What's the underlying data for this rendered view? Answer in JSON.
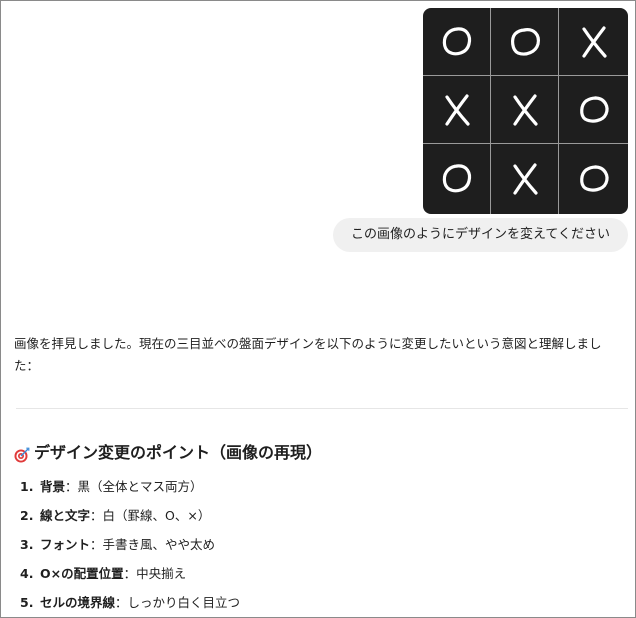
{
  "board": {
    "cells": [
      [
        "O",
        "O",
        "X"
      ],
      [
        "X",
        "X",
        "O"
      ],
      [
        "O",
        "X",
        "O"
      ]
    ],
    "colors": {
      "background": "#1e1e1e",
      "lines": "#9a9a9a",
      "marks": "#ffffff"
    }
  },
  "user_message": "この画像のようにデザインを変えてください",
  "assistant": {
    "intro": "画像を拝見しました。現在の三目並べの盤面デザインを以下のように変更したいという意図と理解しました：",
    "heading_icon": "target-icon",
    "heading": "デザイン変更のポイント（画像の再現）",
    "points": [
      {
        "num": "1.",
        "term": "背景",
        "desc": "：黒（全体とマス両方）"
      },
      {
        "num": "2.",
        "term": "線と文字",
        "desc": "：白（罫線、O、×）"
      },
      {
        "num": "3.",
        "term": "フォント",
        "desc": "：手書き風、やや太め"
      },
      {
        "num": "4.",
        "term": "O×の配置位置",
        "desc": "：中央揃え"
      },
      {
        "num": "5.",
        "term": "セルの境界線",
        "desc": "：しっかり白く目立つ"
      }
    ]
  }
}
